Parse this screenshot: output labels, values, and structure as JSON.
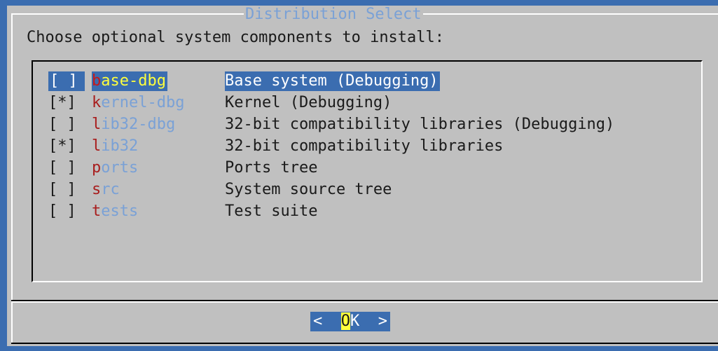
{
  "dialog": {
    "title": "Distribution Select",
    "prompt": "Choose optional system components to install:"
  },
  "items": [
    {
      "check": "[ ]",
      "name_hot": "b",
      "name_rest": "ase-dbg",
      "desc": "Base system (Debugging)",
      "selected": true
    },
    {
      "check": "[*]",
      "name_hot": "k",
      "name_rest": "ernel-dbg",
      "desc": "Kernel (Debugging)",
      "selected": false
    },
    {
      "check": "[ ]",
      "name_hot": "l",
      "name_rest": "ib32-dbg",
      "desc": "32-bit compatibility libraries (Debugging)",
      "selected": false
    },
    {
      "check": "[*]",
      "name_hot": "l",
      "name_rest": "ib32",
      "desc": "32-bit compatibility libraries",
      "selected": false
    },
    {
      "check": "[ ]",
      "name_hot": "p",
      "name_rest": "orts",
      "desc": "Ports tree",
      "selected": false
    },
    {
      "check": "[ ]",
      "name_hot": "s",
      "name_rest": "rc",
      "desc": "System source tree",
      "selected": false
    },
    {
      "check": "[ ]",
      "name_hot": "t",
      "name_rest": "ests",
      "desc": "Test suite",
      "selected": false
    }
  ],
  "buttons": {
    "ok_left": "<  ",
    "ok_hot": "O",
    "ok_rest": "K  >"
  },
  "colors": {
    "background": "#3b6db0",
    "dialog": "#c0c0c0",
    "title": "#7aa1d6",
    "hotkey": "#a81d1d",
    "highlight": "#3b6db0",
    "highlight_text": "#ffff3c"
  }
}
